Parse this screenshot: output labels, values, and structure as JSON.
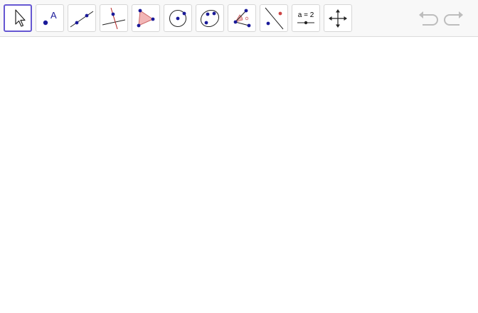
{
  "toolbar": {
    "tools": [
      {
        "icon": "move-arrow-icon",
        "active": true
      },
      {
        "icon": "point-icon",
        "label": "A"
      },
      {
        "icon": "line-through-two-points-icon"
      },
      {
        "icon": "perpendicular-line-icon"
      },
      {
        "icon": "polygon-icon"
      },
      {
        "icon": "circle-center-point-icon"
      },
      {
        "icon": "conic-through-points-icon"
      },
      {
        "icon": "angle-icon"
      },
      {
        "icon": "reflect-about-line-icon"
      },
      {
        "icon": "slider-icon",
        "label": "a = 2"
      },
      {
        "icon": "move-graphics-view-icon"
      }
    ],
    "undo_icon": "undo-icon",
    "redo_icon": "redo-icon"
  },
  "colors": {
    "point": "#1a1a99",
    "accent": "#6557d2",
    "polygon_fill": "#f2b6b6",
    "polygon_stroke": "#cc6666",
    "perpendicular": "#b22222",
    "disabled": "#bdbdbd"
  }
}
